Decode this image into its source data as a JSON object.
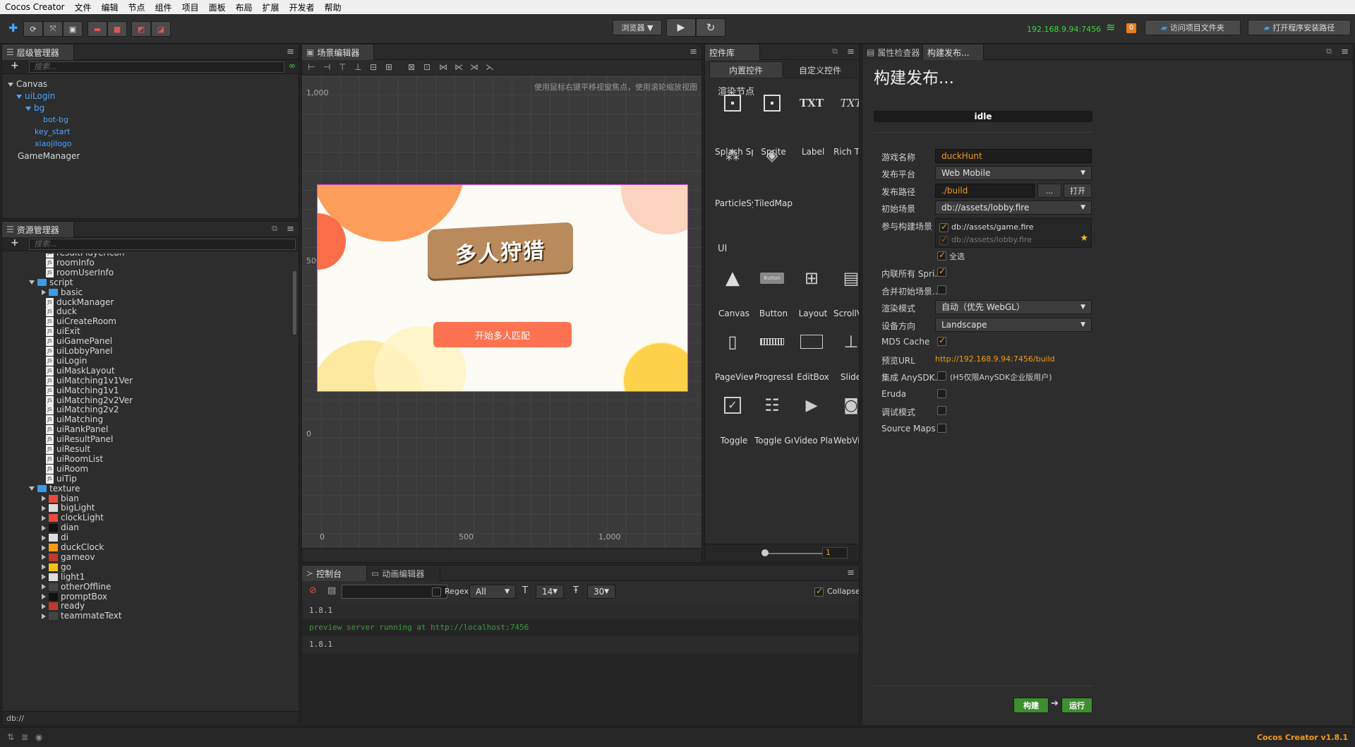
{
  "app": {
    "title": "Cocos Creator",
    "version": "Cocos Creator v1.8.1"
  },
  "menu": [
    "Cocos Creator",
    "文件",
    "编辑",
    "节点",
    "组件",
    "项目",
    "面板",
    "布局",
    "扩展",
    "开发者",
    "帮助"
  ],
  "toolbar": {
    "browser_label": "浏览器 ▼",
    "ip": "192.168.9.94:7456",
    "badge": "0",
    "open_project_folder": "访问项目文件夹",
    "open_install_path": "打开程序安装路径"
  },
  "hierarchy": {
    "title": "层级管理器",
    "search_placeholder": "搜索...",
    "nodes": [
      "Canvas",
      "uiLogin",
      "bg",
      "bot-bg",
      "key_start",
      "xiaojilogo",
      "GameManager"
    ]
  },
  "assets": {
    "title": "资源管理器",
    "search_placeholder": "搜索...",
    "items": [
      "resultPlayerIcon",
      "roomInfo",
      "roomUserInfo",
      "script",
      "basic",
      "duckManager",
      "duck",
      "uiCreateRoom",
      "uiExit",
      "uiGamePanel",
      "uiLobbyPanel",
      "uiLogin",
      "uiMaskLayout",
      "uiMatching1v1Ver",
      "uiMatching1v1",
      "uiMatching2v2Ver",
      "uiMatching2v2",
      "uiMatching",
      "uiRankPanel",
      "uiResultPanel",
      "uiResult",
      "uiRoomList",
      "uiRoom",
      "uiTip",
      "texture",
      "bian",
      "bigLight",
      "clockLight",
      "dian",
      "di",
      "duckClock",
      "gameov",
      "go",
      "light1",
      "otherOffline",
      "promptBox",
      "ready",
      "teammateText"
    ],
    "footer": "db://"
  },
  "scene": {
    "title": "场景编辑器",
    "hint": "使用鼠标右键平移视窗焦点，使用滚轮缩放视图",
    "y_ticks": [
      "1,000",
      "500",
      "0"
    ],
    "x_ticks": [
      "0",
      "500",
      "1,000"
    ],
    "game_button": "开始多人匹配",
    "logo_text": "多人狩猎"
  },
  "widgets": {
    "title": "控件库",
    "tab_builtin": "内置控件",
    "tab_custom": "自定义控件",
    "section_render": "渲染节点",
    "render": [
      "Splash Sp",
      "Sprite",
      "Label",
      "Rich Text",
      "ParticleSy",
      "TiledMap"
    ],
    "section_ui": "UI",
    "ui": [
      "Canvas",
      "Button",
      "Layout",
      "ScrollView",
      "PageView",
      "ProgressB",
      "EditBox",
      "Slider",
      "Toggle",
      "Toggle Gr",
      "Video Pla",
      "WebView"
    ],
    "zoom": "1",
    "label_txt": "TXT",
    "button_txt": "Button"
  },
  "console": {
    "tab_console": "控制台",
    "tab_anim": "动画编辑器",
    "regex": "Regex",
    "filter": "All",
    "font_size": "14",
    "line_height": "30",
    "collapse": "Collapse",
    "lines": [
      "1.8.1",
      "preview server running at http://localhost:7456",
      "1.8.1"
    ]
  },
  "inspector": {
    "tab_props": "属性检查器",
    "tab_build": "构建发布...",
    "heading": "构建发布...",
    "status": "idle",
    "game_name_label": "游戏名称",
    "game_name": "duckHunt",
    "platform_label": "发布平台",
    "platform": "Web Mobile",
    "path_label": "发布路径",
    "path": "./build",
    "path_browse": "...",
    "path_open": "打开",
    "start_scene_label": "初始场景",
    "start_scene": "db://assets/lobby.fire",
    "scenes_label": "参与构建场景",
    "scenes": [
      "db://assets/game.fire",
      "db://assets/lobby.fire"
    ],
    "select_all": "全选",
    "inline_sprite_label": "内联所有 Spri...",
    "merge_scene_label": "合并初始场景...",
    "render_mode_label": "渲染模式",
    "render_mode": "自动（优先 WebGL）",
    "orientation_label": "设备方向",
    "orientation": "Landscape",
    "md5_label": "MD5 Cache",
    "preview_url_label": "预览URL",
    "preview_url": "http://192.168.9.94:7456/build",
    "anysdk_label": "集成 AnySDK...",
    "anysdk_note": "(H5仅限AnySDK企业版用户)",
    "eruda_label": "Eruda",
    "debug_label": "调试模式",
    "sourcemaps_label": "Source Maps",
    "build_btn": "构建",
    "run_btn": "运行"
  },
  "colors": {
    "accent_orange": "#f39c12",
    "link_blue": "#4aa5ff",
    "build_green": "#3d8f2f",
    "ip_green": "#3cd63c"
  }
}
